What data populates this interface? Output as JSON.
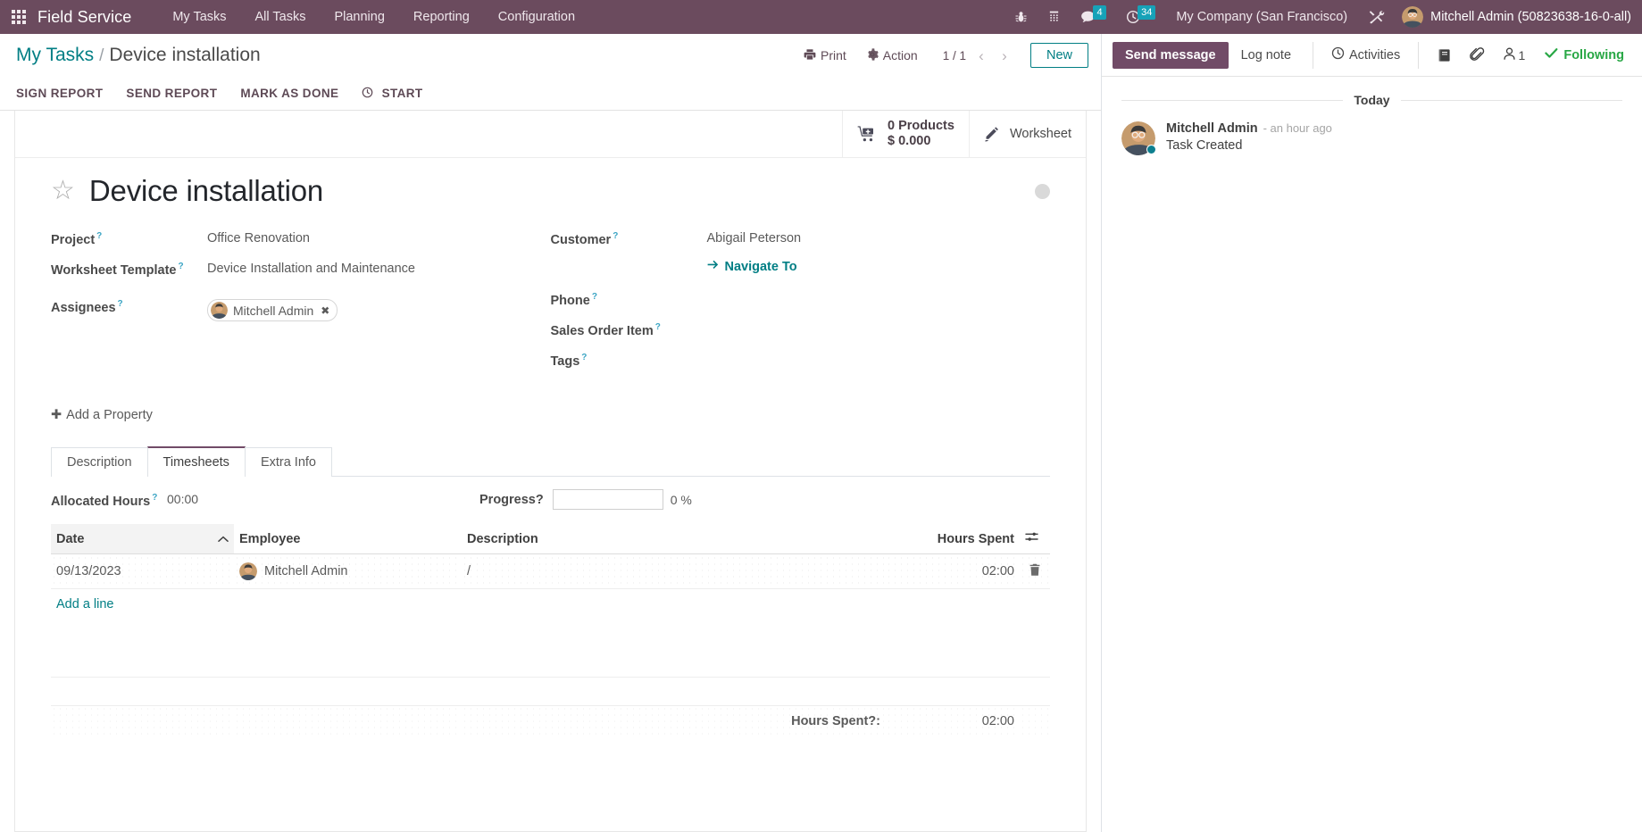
{
  "navbar": {
    "apps_icon": "grid-apps-icon",
    "brand": "Field Service",
    "menu": [
      {
        "label": "My Tasks"
      },
      {
        "label": "All Tasks"
      },
      {
        "label": "Planning"
      },
      {
        "label": "Reporting"
      },
      {
        "label": "Configuration"
      }
    ],
    "icons": [
      {
        "name": "bug-icon"
      },
      {
        "name": "dialpad-icon"
      }
    ],
    "messages": {
      "icon": "chat-icon",
      "count": "4"
    },
    "activities": {
      "icon": "clock-icon",
      "count": "34"
    },
    "company": "My Company (San Francisco)",
    "tools_icon": "tools-icon",
    "user": "Mitchell Admin (50823638-16-0-all)"
  },
  "control_panel": {
    "breadcrumb_root": "My Tasks",
    "breadcrumb_sep": "/",
    "breadcrumb_current": "Device installation",
    "print_label": "Print",
    "action_label": "Action",
    "pager": "1 / 1",
    "prev_icon": "chevron-left-icon",
    "next_icon": "chevron-right-icon",
    "new_label": "New",
    "status_buttons": [
      {
        "label": "SIGN REPORT",
        "icon": ""
      },
      {
        "label": "SEND REPORT",
        "icon": ""
      },
      {
        "label": "MARK AS DONE",
        "icon": ""
      },
      {
        "label": "START",
        "icon": "clock-icon"
      }
    ]
  },
  "stat_buttons": {
    "products": {
      "icon": "cart-plus-icon",
      "count": "0 Products",
      "amount": "$ 0.000"
    },
    "worksheet": {
      "icon": "pencil-icon",
      "label": "Worksheet"
    }
  },
  "record": {
    "star_icon": "star-outline-icon",
    "title": "Device installation",
    "kanban_state_icon": "state-dot-icon",
    "left_fields": [
      {
        "label": "Project",
        "value": "Office Renovation",
        "help": "?"
      },
      {
        "label": "Worksheet Template",
        "value": "Device Installation and Maintenance",
        "help": "?"
      },
      {
        "label": "Assignees",
        "value": "Mitchell Admin",
        "help": "?"
      }
    ],
    "right_fields": [
      {
        "label": "Customer",
        "value": "Abigail Peterson",
        "help": "?"
      },
      {
        "label": "Phone",
        "value": "",
        "help": "?"
      },
      {
        "label": "Sales Order Item",
        "value": "",
        "help": "?"
      },
      {
        "label": "Tags",
        "value": "",
        "help": "?"
      }
    ],
    "navigate_to": "Navigate To",
    "navigate_icon": "arrow-right-icon",
    "add_property": "Add a Property"
  },
  "notebook": {
    "tabs": [
      {
        "label": "Description",
        "active": false
      },
      {
        "label": "Timesheets",
        "active": true
      },
      {
        "label": "Extra Info",
        "active": false
      }
    ]
  },
  "timesheets": {
    "allocated_hours_label": "Allocated Hours",
    "allocated_hours_value": "00:00",
    "progress_label": "Progress",
    "progress_value": "",
    "progress_pct": "0 %",
    "columns": [
      {
        "label": "Date",
        "sorted": true,
        "sort_icon": "chevron-up-icon"
      },
      {
        "label": "Employee"
      },
      {
        "label": "Description"
      },
      {
        "label": "Hours Spent",
        "settings_icon": "sliders-icon"
      }
    ],
    "rows": [
      {
        "date": "09/13/2023",
        "employee": "Mitchell Admin",
        "description": "/",
        "hours": "02:00",
        "delete_icon": "trash-icon"
      }
    ],
    "add_line": "Add a line",
    "total_label": "Hours Spent",
    "total_help": "?",
    "total_colon": ":",
    "total_value": "02:00"
  },
  "chatter": {
    "send_message": "Send message",
    "log_note": "Log note",
    "activities": "Activities",
    "activities_icon": "clock-icon",
    "notes_icon": "notes-icon",
    "attachment_icon": "paperclip-icon",
    "followers_icon": "user-icon",
    "followers_count": "1",
    "following_label": "Following",
    "following_icon": "check-icon",
    "day_separator": "Today",
    "messages": [
      {
        "author": "Mitchell Admin",
        "time": "- an hour ago",
        "body": "Task Created"
      }
    ]
  },
  "colors": {
    "brand_purple": "#714b67",
    "navbar": "#6b4b5e",
    "teal_link": "#017e84",
    "badge": "#17a2b8",
    "following_green": "#28a745"
  }
}
